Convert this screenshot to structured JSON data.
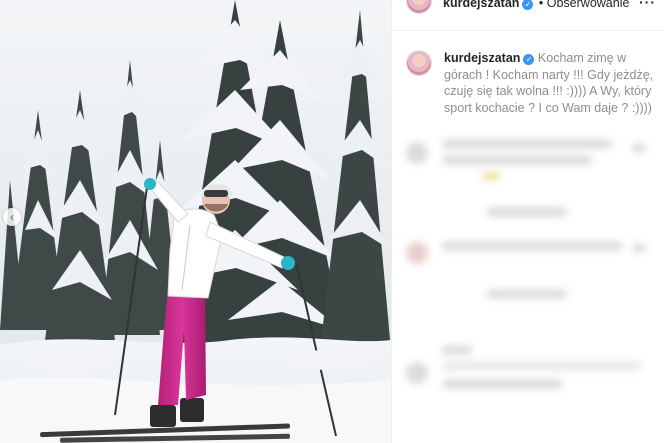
{
  "header": {
    "username": "kurdejszatan",
    "follow_label": "• Obserwowanie",
    "more_icon": "more-horizontal-icon"
  },
  "caption": {
    "username": "kurdejszatan",
    "text": "Kocham zimę w górach ! Kocham narty !!! Gdy jeżdżę, czuję się tak wolna !!! :)))) A Wy, który sport kochacie ? I co Wam daje ? :))))"
  },
  "photo": {
    "carousel_prev_icon": "chevron-left-icon",
    "scene": "skier-snowy-forest"
  },
  "colors": {
    "verified": "#3897f0",
    "text_primary": "#262626",
    "text_secondary": "#8e8e8e",
    "pants": "#c72a86",
    "jacket": "#ffffff"
  }
}
